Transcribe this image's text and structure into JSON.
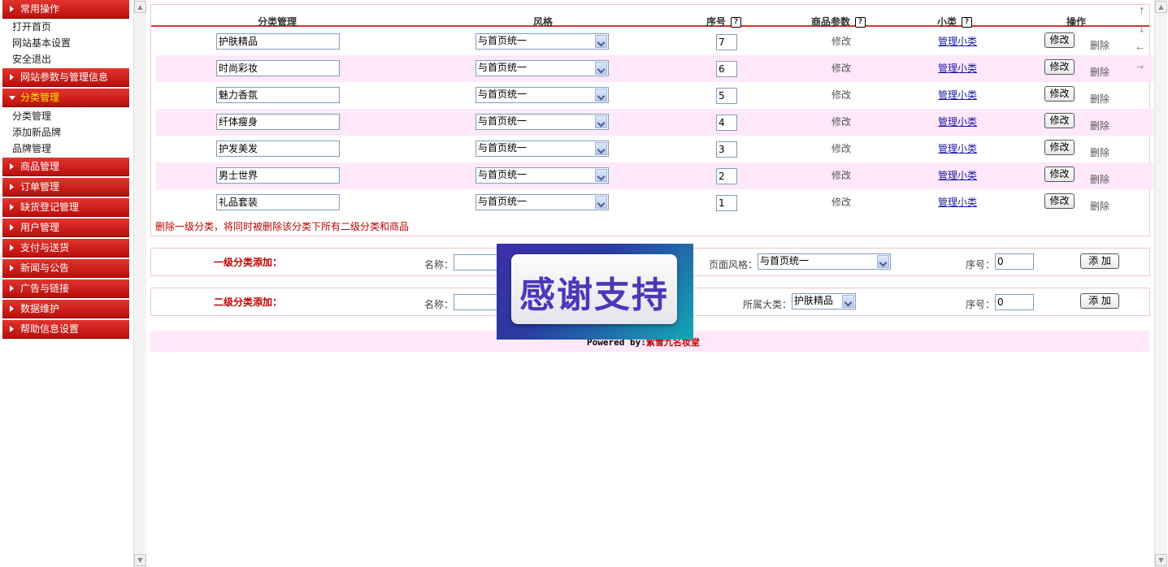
{
  "sidebar": {
    "sections": [
      {
        "label": "常用操作",
        "open": true
      },
      {
        "label": "网站参数与管理信息",
        "open": false
      },
      {
        "label": "分类管理",
        "open": true
      },
      {
        "label": "商品管理",
        "open": false
      },
      {
        "label": "订单管理",
        "open": false
      },
      {
        "label": "缺货登记管理",
        "open": false
      },
      {
        "label": "用户管理",
        "open": false
      },
      {
        "label": "支付与送货",
        "open": false
      },
      {
        "label": "新闻与公告",
        "open": false
      },
      {
        "label": "广告与链接",
        "open": false
      },
      {
        "label": "数据维护",
        "open": false
      },
      {
        "label": "帮助信息设置",
        "open": false
      }
    ],
    "common_items": [
      "打开首页",
      "网站基本设置",
      "安全退出"
    ],
    "category_items": [
      "分类管理",
      "添加新品牌",
      "品牌管理"
    ]
  },
  "table": {
    "headers": {
      "name": "分类管理",
      "style": "风格",
      "order": "序号",
      "params": "商品参数",
      "sub": "小类",
      "action": "操作"
    },
    "help_icon": "?",
    "rows": [
      {
        "name": "护肤精品",
        "style": "与首页统一",
        "order": "7",
        "params": "修改",
        "sub": "管理小类",
        "modify": "修改",
        "delete": "删除"
      },
      {
        "name": "时尚彩妆",
        "style": "与首页统一",
        "order": "6",
        "params": "修改",
        "sub": "管理小类",
        "modify": "修改",
        "delete": "删除"
      },
      {
        "name": "魅力香氛",
        "style": "与首页统一",
        "order": "5",
        "params": "修改",
        "sub": "管理小类",
        "modify": "修改",
        "delete": "删除"
      },
      {
        "name": "纤体瘦身",
        "style": "与首页统一",
        "order": "4",
        "params": "修改",
        "sub": "管理小类",
        "modify": "修改",
        "delete": "删除"
      },
      {
        "name": "护发美发",
        "style": "与首页统一",
        "order": "3",
        "params": "修改",
        "sub": "管理小类",
        "modify": "修改",
        "delete": "删除"
      },
      {
        "name": "男士世界",
        "style": "与首页统一",
        "order": "2",
        "params": "修改",
        "sub": "管理小类",
        "modify": "修改",
        "delete": "删除"
      },
      {
        "name": "礼品套装",
        "style": "与首页统一",
        "order": "1",
        "params": "修改",
        "sub": "管理小类",
        "modify": "修改",
        "delete": "删除"
      }
    ],
    "warning": "删除一级分类，将同时被删除该分类下所有二级分类和商品"
  },
  "add_level1": {
    "title": "一级分类添加：",
    "name_label": "名称：",
    "name_value": "",
    "style_label": "页面风格：",
    "style_value": "与首页统一",
    "order_label": "序号：",
    "order_value": "0",
    "button": "添 加"
  },
  "add_level2": {
    "title": "二级分类添加：",
    "name_label": "名称：",
    "name_value": "",
    "parent_label": "所属大类：",
    "parent_value": "护肤精品",
    "order_label": "序号：",
    "order_value": "0",
    "button": "添 加"
  },
  "footer": {
    "powered_prefix": "Powered by:",
    "powered_name": "紫雪九名妆堂"
  },
  "overlay": {
    "text": "感谢支持"
  },
  "colors": {
    "menu_red": "#c8201c",
    "row_alt": "#ffe8fa",
    "link": "#1a1aa6",
    "warning": "#c00000"
  }
}
